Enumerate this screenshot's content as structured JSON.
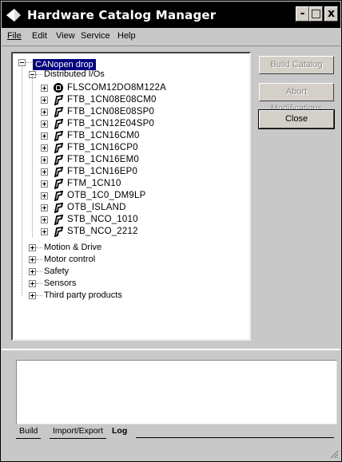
{
  "window": {
    "title": "Hardware Catalog Manager",
    "minimize": "-",
    "maximize": "□",
    "close": "x"
  },
  "menu": [
    "File",
    "Edit",
    "View",
    "Service",
    "Help"
  ],
  "tree": {
    "root": "CANopen drop",
    "group_open": "Distributed I/Os",
    "devices": [
      "FLSCOM12DO8M122A",
      "FTB_1CN08E08CM0",
      "FTB_1CN08E08SP0",
      "FTB_1CN12E04SP0",
      "FTB_1CN16CM0",
      "FTB_1CN16CP0",
      "FTB_1CN16EM0",
      "FTB_1CN16EP0",
      "FTM_1CN10",
      "OTB_1C0_DM9LP",
      "OTB_ISLAND",
      "STB_NCO_1010",
      "STB_NCO_2212"
    ],
    "groups_closed": [
      "Motion & Drive",
      "Motor control",
      "Safety",
      "Sensors",
      "Third party products"
    ]
  },
  "buttons": {
    "build": "Build Catalog",
    "abort": "Abort Modifications",
    "close": "Close"
  },
  "tabs": [
    "Build",
    "Import/Export",
    "Log"
  ],
  "colors": {
    "title_bg": "#000000",
    "selection": "#000080",
    "disabled_text": "#8a8a8a"
  }
}
